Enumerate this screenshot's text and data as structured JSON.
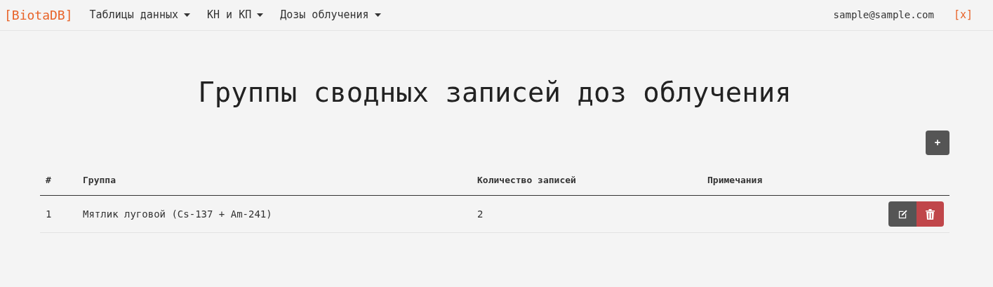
{
  "navbar": {
    "brand": "[BiotaDB]",
    "menus": [
      "Таблицы данных",
      "КН и КП",
      "Дозы облучения"
    ],
    "user": "sample@sample.com",
    "logout": "[x]"
  },
  "title": "Группы сводных записей доз облучения",
  "add_button": "+",
  "table": {
    "columns": [
      "#",
      "Группа",
      "Количество записей",
      "Примечания"
    ],
    "rows": [
      {
        "cells": [
          "1",
          "Мятлик луговой (Cs-137 + Am-241)",
          "2",
          ""
        ]
      }
    ]
  }
}
